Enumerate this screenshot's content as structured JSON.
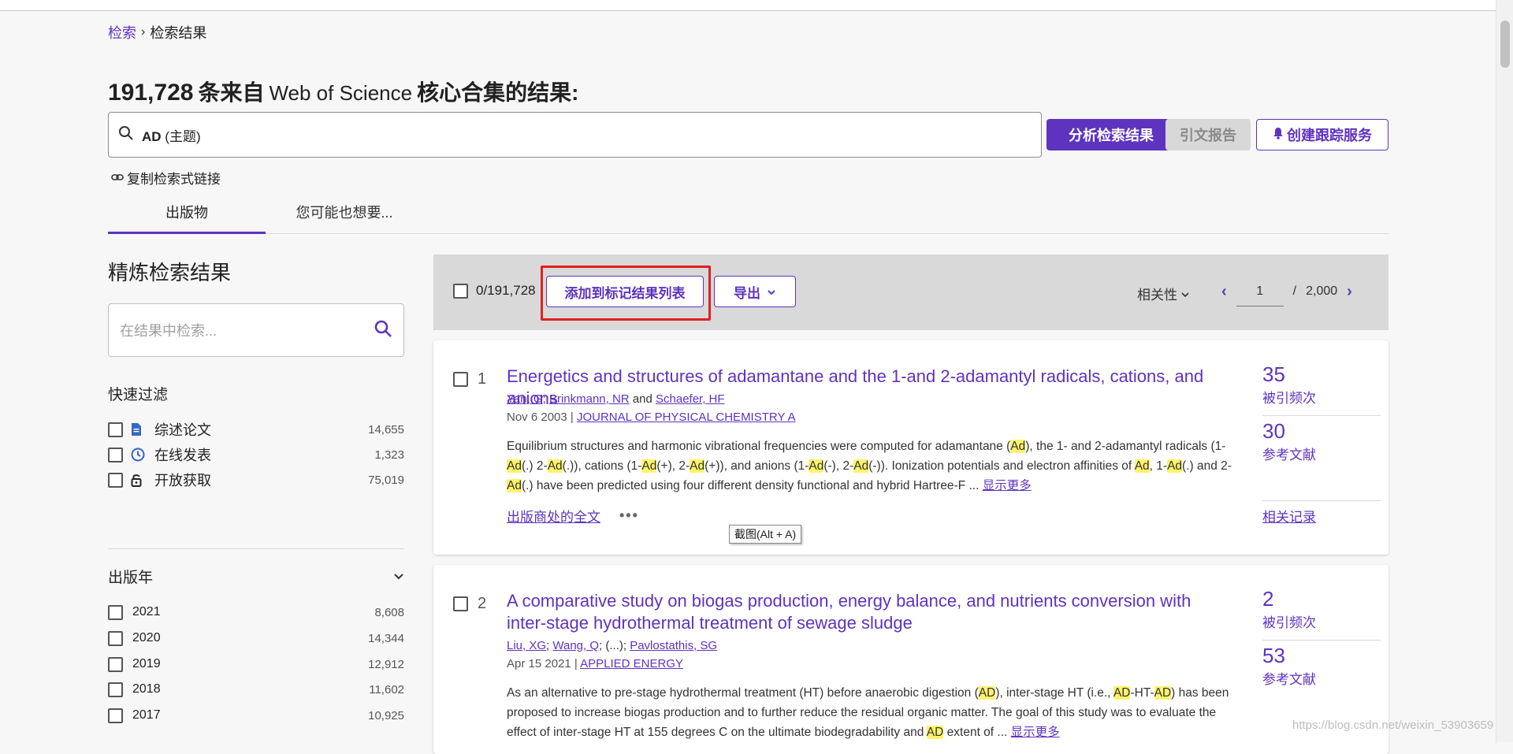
{
  "breadcrumb": {
    "root": "检索",
    "separator": "›",
    "current": "检索结果"
  },
  "headline": {
    "count": "191,728",
    "prefix": "条来自",
    "database": "Web of Science",
    "suffix": "核心合集的结果:"
  },
  "search": {
    "query": "AD",
    "field": "(主题)"
  },
  "actions": {
    "analyze": "分析检索结果",
    "citation_report": "引文报告",
    "create_alert": "创建跟踪服务",
    "copy_query_link": "复制检索式链接"
  },
  "tabs": [
    {
      "label": "出版物"
    },
    {
      "label": "您可能也想要..."
    }
  ],
  "refine": {
    "title": "精炼检索结果",
    "search_placeholder": "在结果中检索...",
    "quick_filters_title": "快速过滤",
    "quick_filters": [
      {
        "label": "综述论文",
        "count": "14,655",
        "icon": "document-icon"
      },
      {
        "label": "在线发表",
        "count": "1,323",
        "icon": "clock-icon"
      },
      {
        "label": "开放获取",
        "count": "75,019",
        "icon": "lock-icon"
      }
    ],
    "year_title": "出版年",
    "years": [
      {
        "label": "2021",
        "count": "8,608"
      },
      {
        "label": "2020",
        "count": "14,344"
      },
      {
        "label": "2019",
        "count": "12,912"
      },
      {
        "label": "2018",
        "count": "11,602"
      },
      {
        "label": "2017",
        "count": "10,925"
      }
    ]
  },
  "toolbar": {
    "selected": "0/191,728",
    "add_to_marked": "添加到标记结果列表",
    "export": "导出",
    "sort": "相关性",
    "page": "1",
    "page_sep": "/",
    "total_pages": "2,000"
  },
  "results": [
    {
      "index": "1",
      "title": "Energetics and structures of adamantane and the 1-and 2-adamantyl radicals, cations, and anions",
      "authors": [
        "Yan, G",
        "Brinkmann, NR",
        "Schaefer, HF"
      ],
      "author_sep1": ";",
      "author_and": "and",
      "date": "Nov 6 2003",
      "journal": "JOURNAL OF PHYSICAL CHEMISTRY A",
      "citations": "35",
      "citations_label": "被引频次",
      "references": "30",
      "references_label": "参考文献",
      "related": "相关记录",
      "full_text": "出版商处的全文",
      "show_more": "显示更多"
    },
    {
      "index": "2",
      "title": "A comparative study on biogas production, energy balance, and nutrients conversion with inter-stage hydrothermal treatment of sewage sludge",
      "authors": [
        "Liu, XG",
        "Wang, Q",
        "Pavlostathis, SG"
      ],
      "author_sep": ";",
      "author_ellipsis": "(...)",
      "date": "Apr 15 2021",
      "journal": "APPLIED ENERGY",
      "citations": "2",
      "citations_label": "被引频次",
      "references": "53",
      "references_label": "参考文献",
      "show_more": "显示更多"
    }
  ],
  "tooltip": "截图(Alt + A)",
  "watermark": "https://blog.csdn.net/weixin_53903659",
  "colors": {
    "accent": "#5e33bf",
    "highlight": "#fff36b",
    "annotation_red": "#e02020"
  }
}
